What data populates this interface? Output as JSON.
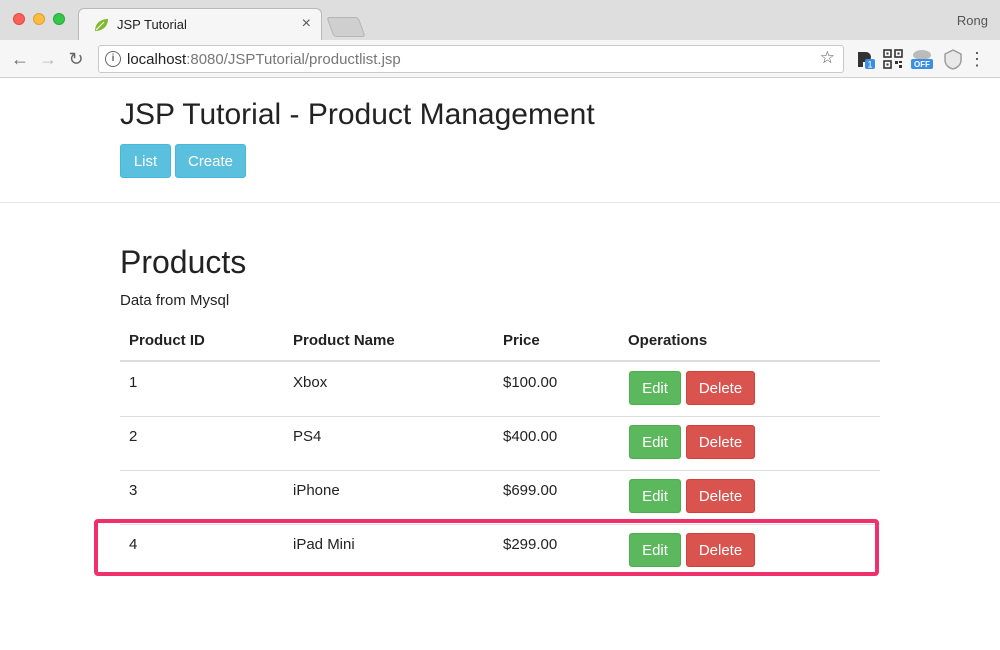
{
  "browser": {
    "tab_title": "JSP Tutorial",
    "tab_close": "×",
    "profile_name": "Rong",
    "url_host": "localhost",
    "url_rest": ":8080/JSPTutorial/productlist.jsp",
    "ext_badge_count": "1",
    "ext_off_label": "OFF"
  },
  "header": {
    "title": "JSP Tutorial - Product Management",
    "list_button": "List",
    "create_button": "Create"
  },
  "main": {
    "title": "Products",
    "subtitle": "Data from Mysql",
    "columns": [
      "Product ID",
      "Product Name",
      "Price",
      "Operations"
    ],
    "rows": [
      {
        "id": "1",
        "name": "Xbox",
        "price": "$100.00",
        "edit": "Edit",
        "delete": "Delete"
      },
      {
        "id": "2",
        "name": "PS4",
        "price": "$400.00",
        "edit": "Edit",
        "delete": "Delete"
      },
      {
        "id": "3",
        "name": "iPhone",
        "price": "$699.00",
        "edit": "Edit",
        "delete": "Delete"
      },
      {
        "id": "4",
        "name": "iPad Mini",
        "price": "$299.00",
        "edit": "Edit",
        "delete": "Delete"
      }
    ]
  },
  "colors": {
    "info": "#5bc0de",
    "success": "#5cb85c",
    "danger": "#d9534f",
    "highlight": "#f0306b"
  }
}
